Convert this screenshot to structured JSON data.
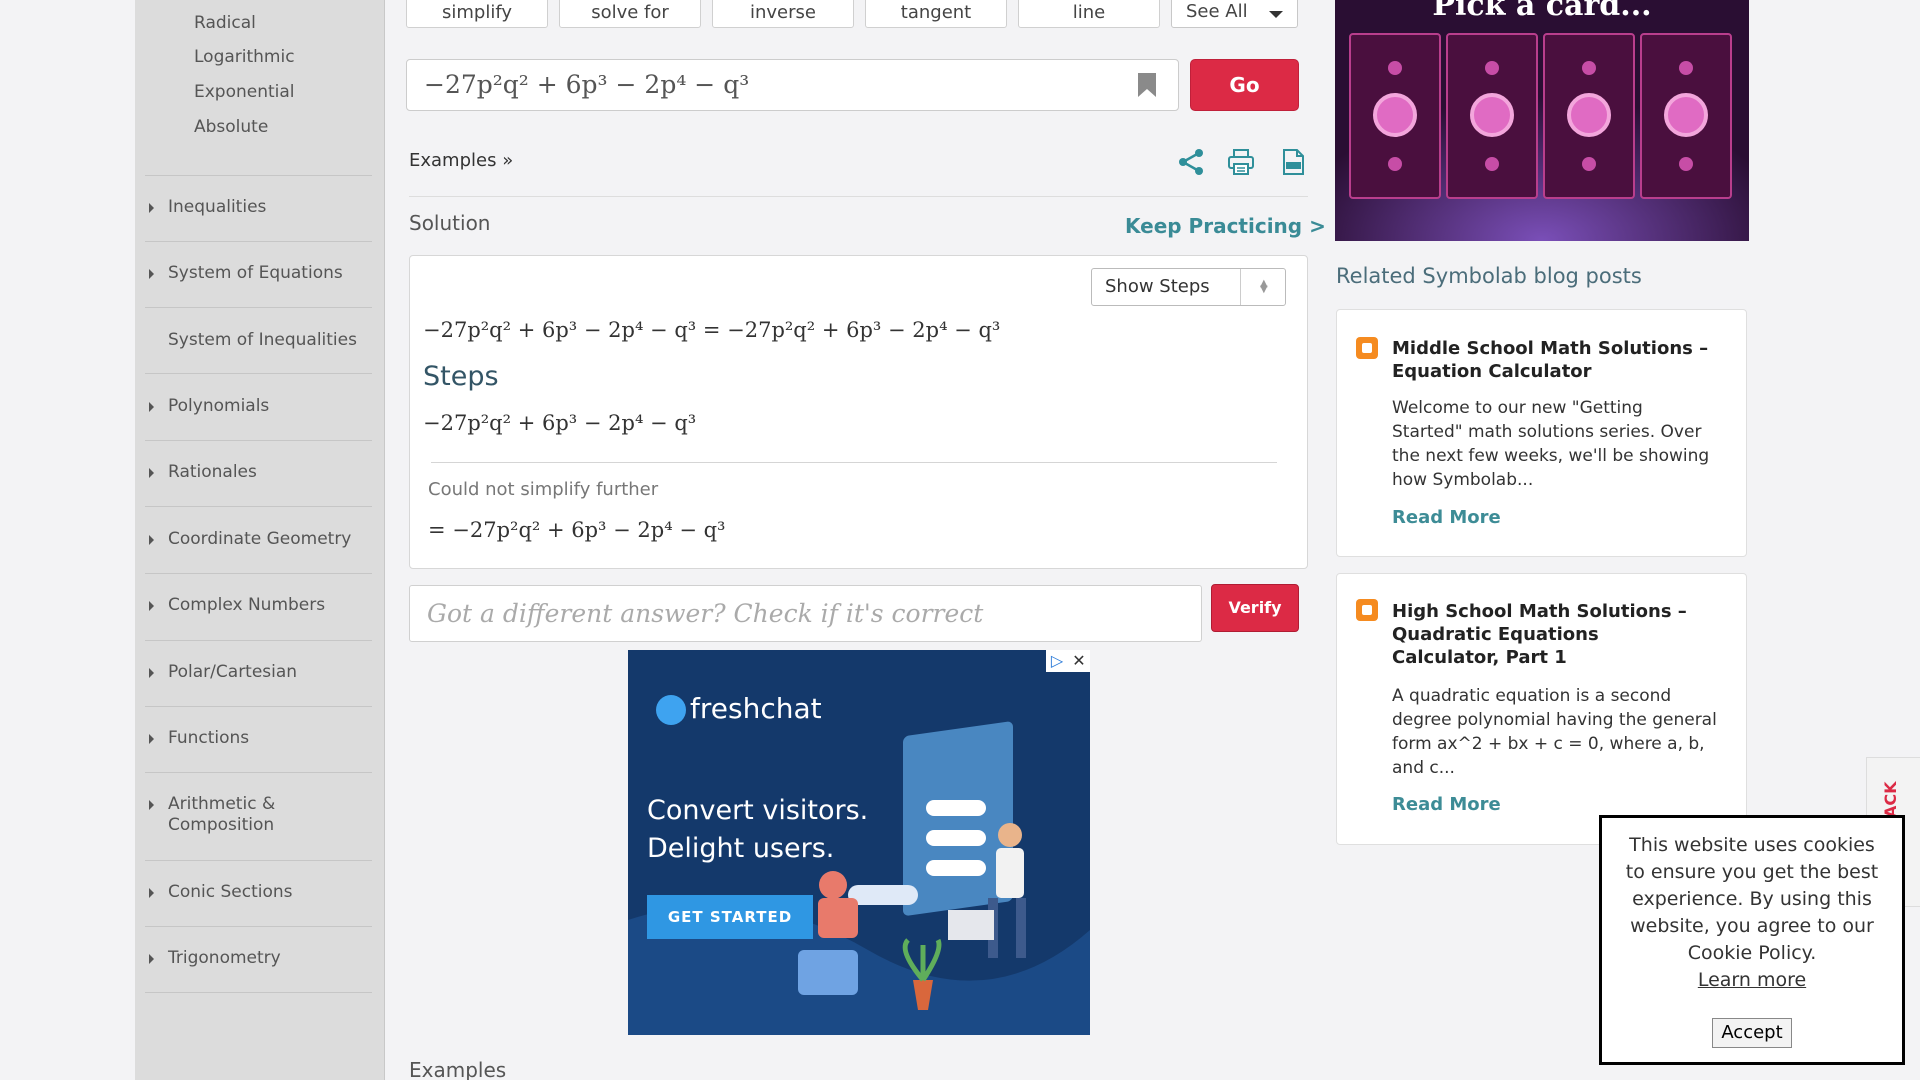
{
  "sidebar": {
    "sub_items": [
      "Radical",
      "Logarithmic",
      "Exponential",
      "Absolute"
    ],
    "items": [
      "Inequalities",
      "System of Equations",
      "System of Inequalities",
      "Polynomials",
      "Rationales",
      "Coordinate Geometry",
      "Complex Numbers",
      "Polar/Cartesian",
      "Functions",
      "Arithmetic & Composition",
      "Conic Sections",
      "Trigonometry"
    ]
  },
  "tabs": [
    "simplify",
    "solve for",
    "inverse",
    "tangent",
    "line"
  ],
  "see_all": "See All",
  "query": "−27p²q² + 6p³ − 2p⁴ − q³",
  "go_label": "Go",
  "examples_link": "Examples »",
  "solution_title": "Solution",
  "keep_practicing": "Keep Practicing >",
  "show_steps": "Show Steps",
  "result_equation": "−27p²q² + 6p³ − 2p⁴ − q³ = −27p²q² + 6p³ − 2p⁴ − q³",
  "steps_title": "Steps",
  "step_expression": "−27p²q² + 6p³ − 2p⁴ − q³",
  "no_simplify": "Could not simplify further",
  "final_result": "= −27p²q² + 6p³ − 2p⁴ − q³",
  "check_placeholder": "Got a different answer? Check if it's correct",
  "verify_label": "Verify",
  "ad": {
    "brand": "freshchat",
    "headline": "Convert visitors. Delight users.",
    "cta": "GET STARTED"
  },
  "examples_footer": "Examples",
  "game_banner_title": "Pick a card...",
  "blog": {
    "title": "Related Symbolab blog posts",
    "posts": [
      {
        "heading": "Middle School Math Solutions – Equation Calculator",
        "body": "Welcome to our new \"Getting Started\" math solutions series. Over the next few weeks, we'll be showing how Symbolab...",
        "more": "Read More"
      },
      {
        "heading": "High School Math Solutions – Quadratic Equations Calculator, Part 1",
        "body": "A quadratic equation is a second degree polynomial having the general form ax^2 + bx + c = 0, where a, b, and c...",
        "more": "Read More"
      }
    ]
  },
  "feedback_tab": "ACK",
  "cookie": {
    "text": "This website uses cookies to ensure you get the best experience. By using this website, you agree to our Cookie Policy.",
    "learn_more": "Learn more",
    "accept": "Accept"
  },
  "colors": {
    "accent_red": "#dc2a45",
    "teal": "#3a8b96",
    "sidebar_bg": "#dcdcdc"
  }
}
